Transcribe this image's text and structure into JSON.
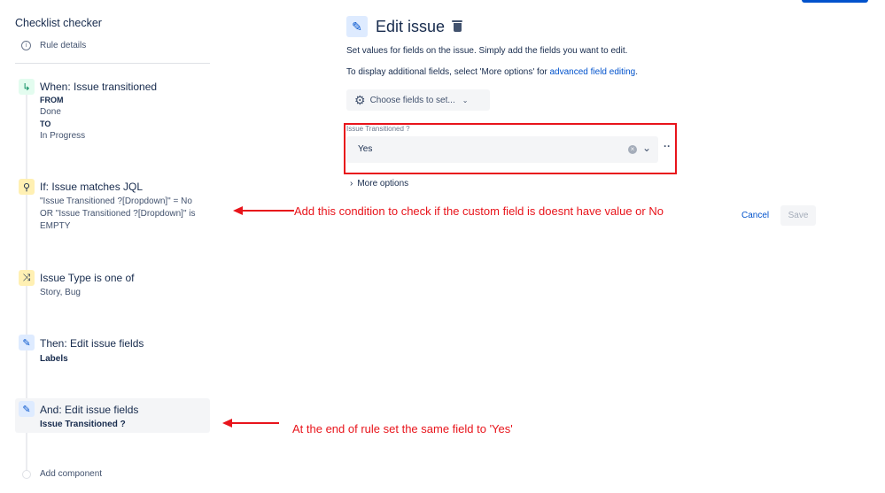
{
  "sidebar": {
    "title": "Checklist checker",
    "rule_details": "Rule details",
    "items": [
      {
        "title": "When: Issue transitioned",
        "lines": [
          "FROM",
          "Done",
          "TO",
          "In Progress"
        ],
        "icon": "transition-icon"
      },
      {
        "title": "If: Issue matches JQL",
        "lines": [
          "\"Issue Transitioned ?[Dropdown]\" = No",
          "OR \"Issue Transitioned ?[Dropdown]\" is",
          "EMPTY"
        ],
        "icon": "search-icon"
      },
      {
        "title": "Issue Type is one of",
        "lines": [
          "Story, Bug"
        ],
        "icon": "shuffle-icon"
      },
      {
        "title": "Then: Edit issue fields",
        "lines": [
          "Labels"
        ],
        "icon": "pencil-icon"
      },
      {
        "title": "And: Edit issue fields",
        "lines": [
          "Issue Transitioned ?"
        ],
        "icon": "pencil-icon"
      }
    ],
    "add_component": "Add component"
  },
  "main": {
    "title": "Edit issue",
    "desc1": "Set values for fields on the issue. Simply add the fields you want to edit.",
    "desc2_prefix": "To display additional fields, select 'More options' for ",
    "desc2_link": "advanced field editing",
    "desc2_suffix": ".",
    "choose_fields": "Choose fields to set...",
    "field_label": "Issue Transitioned ?",
    "field_value": "Yes",
    "more_options": "More options",
    "cancel": "Cancel",
    "save": "Save"
  },
  "annotations": {
    "note1": "Add this condition to check if the custom field is doesnt have value or No",
    "note2": "At the end of rule set the same field to 'Yes'"
  }
}
